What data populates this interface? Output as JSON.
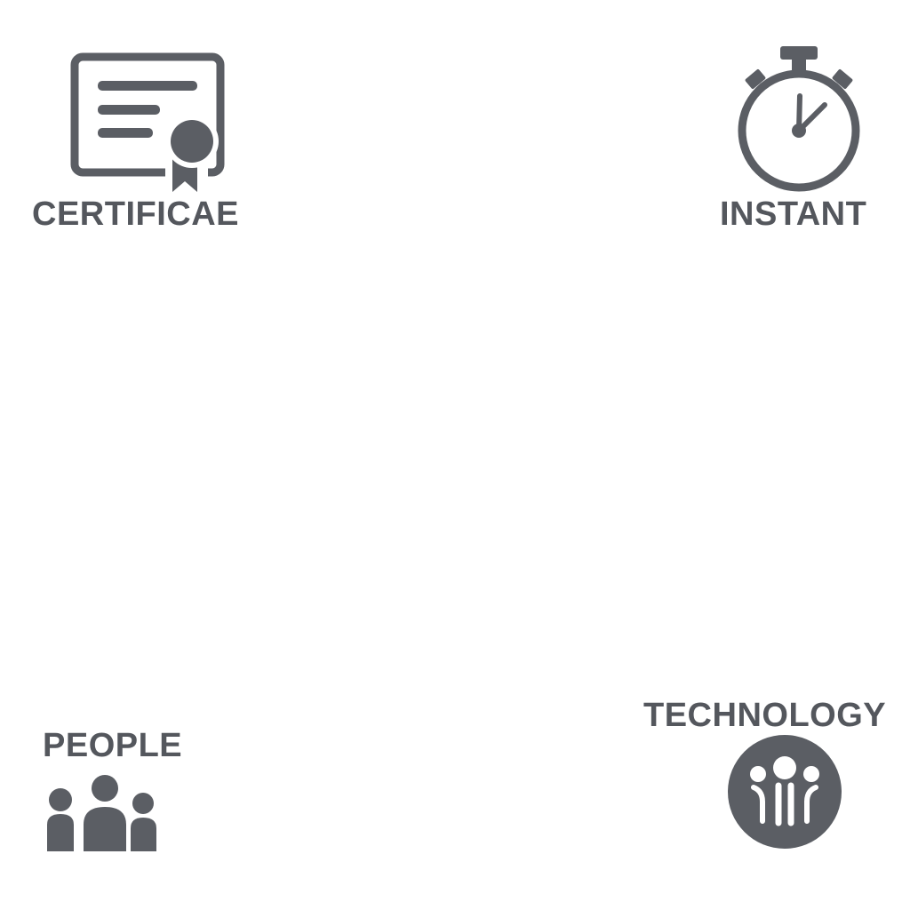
{
  "colors": {
    "icon": "#5b5e64",
    "background": "#ffffff"
  },
  "tiles": {
    "certificate": {
      "icon": "certificate-icon",
      "label": "CERTIFICAE"
    },
    "instant": {
      "icon": "stopwatch-icon",
      "label": "INSTANT"
    },
    "people": {
      "icon": "people-group-icon",
      "label": "PEOPLE"
    },
    "technology": {
      "icon": "technology-people-icon",
      "label": "TECHNOLOGY"
    }
  }
}
